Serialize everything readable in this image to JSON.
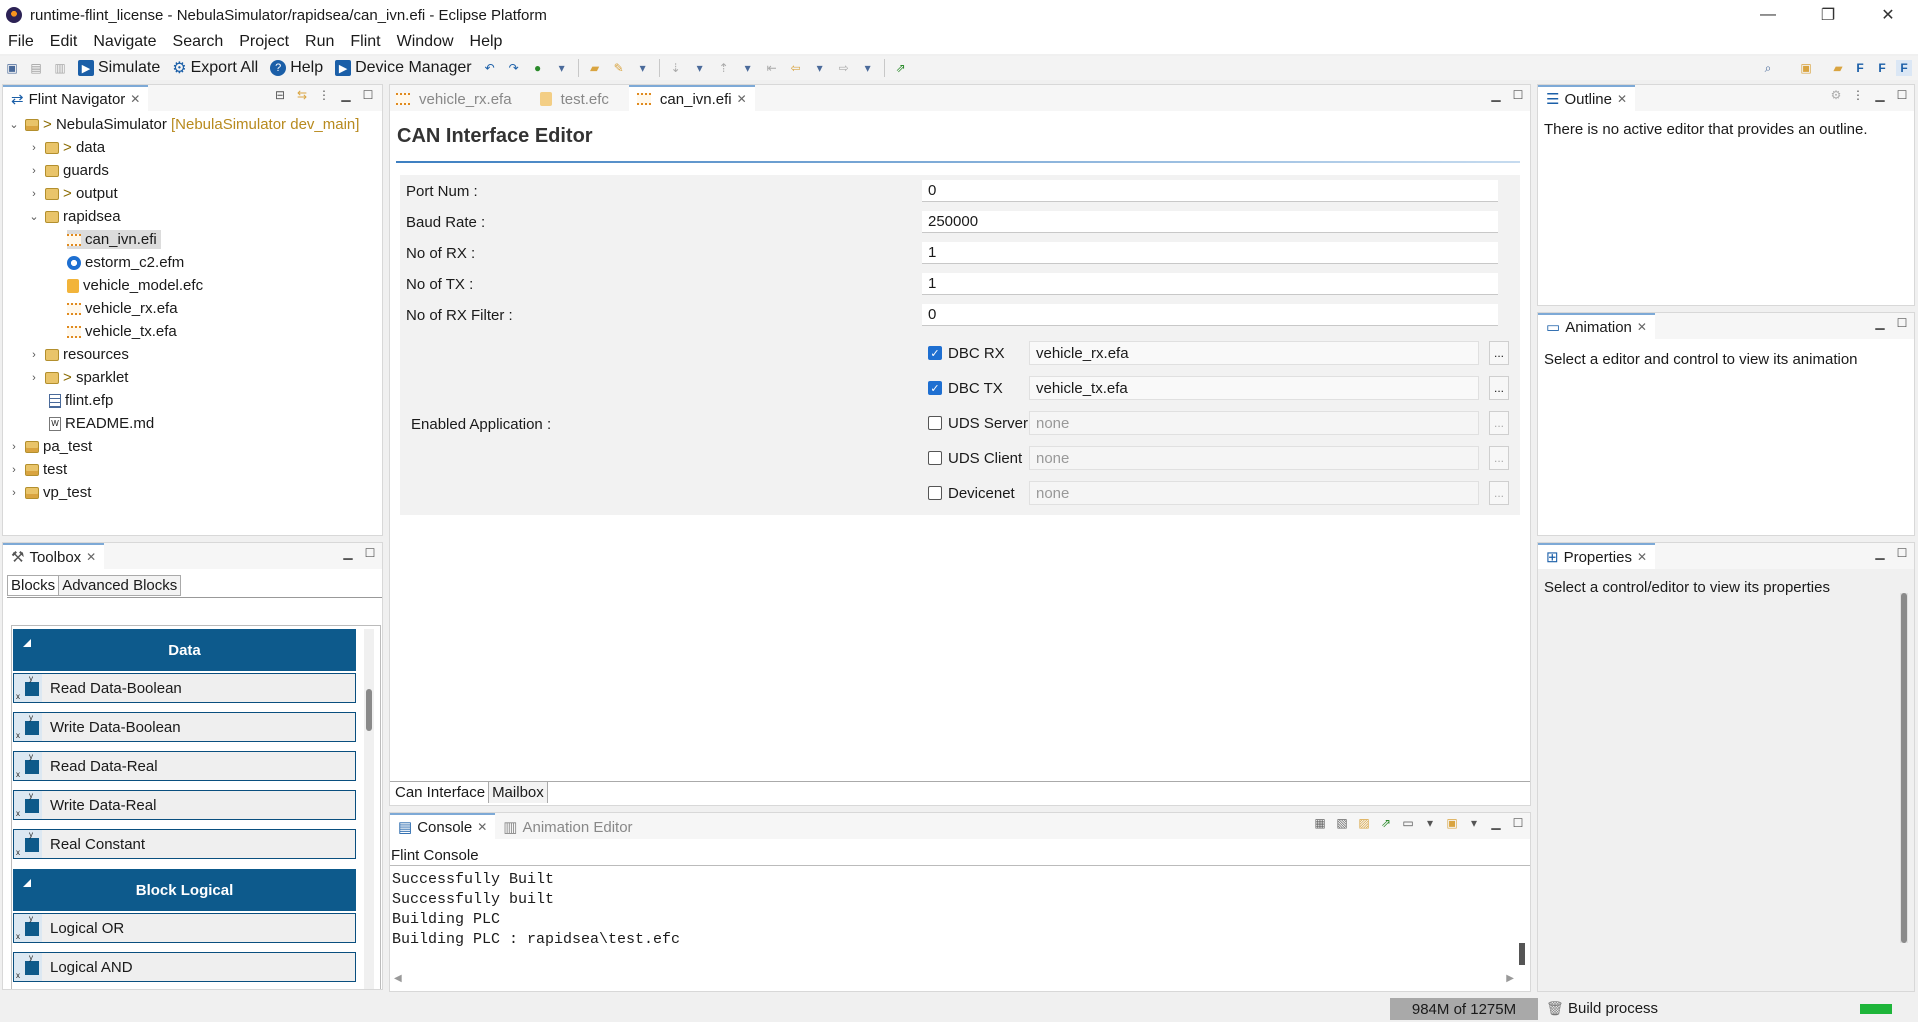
{
  "window": {
    "title": "runtime-flint_license - NebulaSimulator/rapidsea/can_ivn.efi - Eclipse Platform",
    "minimize": "—",
    "restore": "❐",
    "close": "✕"
  },
  "menu": [
    "File",
    "Edit",
    "Navigate",
    "Search",
    "Project",
    "Run",
    "Flint",
    "Window",
    "Help"
  ],
  "toolbar": {
    "simulate": "Simulate",
    "export_all": "Export All",
    "help": "Help",
    "device_manager": "Device Manager"
  },
  "navigator": {
    "tab": "Flint Navigator",
    "project_name": "NebulaSimulator",
    "project_branch": "[NebulaSimulator dev_main]",
    "project_prefix": ">",
    "items": [
      {
        "label": "data",
        "prefix": ">"
      },
      {
        "label": "guards",
        "prefix": ""
      },
      {
        "label": "output",
        "prefix": ">"
      },
      {
        "label": "rapidsea",
        "prefix": ""
      },
      {
        "label": "can_ivn.efi"
      },
      {
        "label": "estorm_c2.efm"
      },
      {
        "label": "vehicle_model.efc"
      },
      {
        "label": "vehicle_rx.efa"
      },
      {
        "label": "vehicle_tx.efa"
      },
      {
        "label": "resources",
        "prefix": ""
      },
      {
        "label": "sparklet",
        "prefix": ">"
      },
      {
        "label": "flint.efp"
      },
      {
        "label": "README.md"
      },
      {
        "label": "pa_test"
      },
      {
        "label": "test"
      },
      {
        "label": "vp_test"
      }
    ]
  },
  "editor": {
    "tabs": [
      {
        "label": "vehicle_rx.efa",
        "active": false
      },
      {
        "label": "test.efc",
        "active": false
      },
      {
        "label": "can_ivn.efi",
        "active": true
      }
    ],
    "title": "CAN Interface Editor",
    "fields": [
      {
        "label": "Port Num :",
        "value": "0"
      },
      {
        "label": "Baud Rate :",
        "value": "250000"
      },
      {
        "label": "No of RX :",
        "value": "1"
      },
      {
        "label": "No of TX :",
        "value": "1"
      },
      {
        "label": "No of RX Filter :",
        "value": "0"
      }
    ],
    "enabled_app_label": "Enabled Application :",
    "apps": [
      {
        "label": "DBC RX",
        "checked": true,
        "value": "vehicle_rx.efa"
      },
      {
        "label": "DBC TX",
        "checked": true,
        "value": "vehicle_tx.efa"
      },
      {
        "label": "UDS Server",
        "checked": false,
        "value": "none"
      },
      {
        "label": "UDS Client",
        "checked": false,
        "value": "none"
      },
      {
        "label": "Devicenet",
        "checked": false,
        "value": "none"
      }
    ],
    "browse": "...",
    "bottom_tabs": [
      "Can Interface",
      "Mailbox"
    ]
  },
  "outline": {
    "tab": "Outline",
    "message": "There is no active editor that provides an outline."
  },
  "animation": {
    "tab": "Animation",
    "message": "Select a editor and control to view its animation"
  },
  "properties": {
    "tab": "Properties",
    "message": "Select a control/editor to view its properties"
  },
  "toolbox": {
    "tab": "Toolbox",
    "subtabs": [
      "Blocks",
      "Advanced Blocks"
    ],
    "groups": [
      {
        "header": "Data",
        "items": [
          "Read Data-Boolean",
          "Write Data-Boolean",
          "Read Data-Real",
          "Write Data-Real",
          "Real Constant"
        ]
      },
      {
        "header": "Block Logical",
        "items": [
          "Logical OR",
          "Logical AND"
        ]
      }
    ]
  },
  "console": {
    "tabs": [
      "Console",
      "Animation Editor"
    ],
    "name": "Flint Console",
    "lines": [
      "Successfully Built",
      "Successfully built",
      "Building PLC",
      "Building PLC : rapidsea\\test.efc"
    ]
  },
  "status": {
    "memory": "984M of 1275M",
    "build": "Build process"
  },
  "colors": {
    "accent": "#0d5a8c",
    "checkbox": "#1e6fd1",
    "progress": "#1eb53a"
  }
}
